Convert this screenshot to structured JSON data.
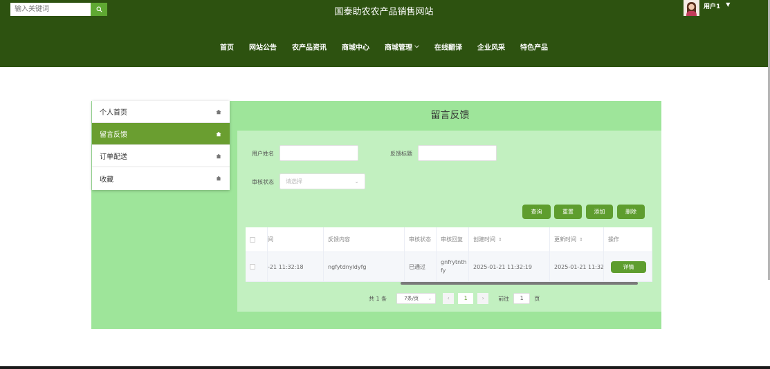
{
  "header": {
    "search_placeholder": "输入关键词",
    "site_title": "国泰助农农产品销售网站",
    "user_name": "用户1"
  },
  "nav": {
    "items": [
      "首页",
      "网站公告",
      "农产品资讯",
      "商城中心",
      "商城管理",
      "在线翻译",
      "企业风采",
      "特色产品"
    ]
  },
  "side_menu": {
    "items": [
      "个人首页",
      "留言反馈",
      "订单配送",
      "收藏"
    ],
    "active_index": 1
  },
  "content": {
    "title": "留言反馈",
    "filters": {
      "user_name_label": "用户姓名",
      "user_name_value": "",
      "feedback_title_label": "反馈标题",
      "feedback_title_value": "",
      "review_status_label": "审核状态",
      "review_status_placeholder": "请选择"
    },
    "buttons": {
      "query": "查询",
      "reset": "重置",
      "add": "添加",
      "delete": "删除"
    },
    "table": {
      "headers": [
        "间",
        "反馈内容",
        "审核状态",
        "审核回复",
        "创建时间",
        "更新时间",
        "操作"
      ],
      "rows": [
        {
          "time": "-21 11:32:18",
          "content": "ngfytdnyldyfg",
          "status": "已通过",
          "reply_line1": "gnfrytnth",
          "reply_line2": "fy",
          "created": "2025-01-21 11:32:19",
          "updated": "2025-01-21 11:32:57",
          "action": "详情"
        }
      ]
    },
    "pagination": {
      "total": "共 1 条",
      "page_size": "7条/页",
      "current_page": "1",
      "goto_label": "前往",
      "goto_value": "1",
      "page_suffix": "页"
    }
  },
  "colors": {
    "header_bg": "#2d5210",
    "accent": "#5e9d2e",
    "panel_bg": "#9ee59a",
    "content_bg": "#c2f0c0"
  }
}
